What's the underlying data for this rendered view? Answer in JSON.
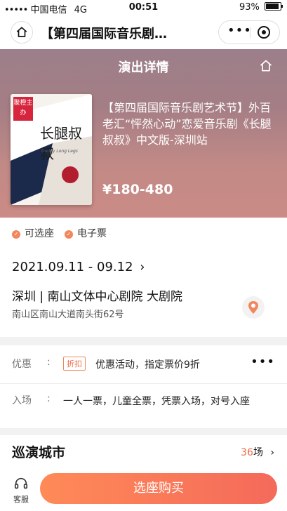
{
  "status_bar": {
    "carrier": "中国电信",
    "network": "4G",
    "time": "00:51",
    "battery": "93%"
  },
  "nav": {
    "title": "【第四届国际音乐剧…"
  },
  "hero": {
    "title": "演出详情",
    "poster": {
      "badge": "聚橙主办",
      "title": "长腿叔叔",
      "subtitle": "Daddy Long Legs"
    },
    "show_name": "【第四届国际音乐剧艺术节】外百老汇“怦然心动”恋爱音乐剧《长腿叔叔》中文版-深圳站",
    "price": "¥180-480"
  },
  "tags": [
    {
      "label": "可选座"
    },
    {
      "label": "电子票"
    }
  ],
  "info": {
    "date": "2021.09.11 - 09.12",
    "venue": "深圳 | 南山文体中心剧院 大剧院",
    "address": "南山区南山大道南头街62号"
  },
  "promo": {
    "label": "优惠",
    "badge": "折扣",
    "text": "优惠活动，指定票价9折",
    "entry_label": "入场",
    "entry_text": "一人一票，儿童全票，凭票入场，对号入座"
  },
  "tour": {
    "title": "巡演城市",
    "count": "36",
    "unit": "场"
  },
  "bottom": {
    "service_label": "客服",
    "buy_label": "选座购买"
  },
  "colors": {
    "accent": "#f06a45",
    "buy_gradient_start": "#ff8a57",
    "buy_gradient_end": "#f46a5b"
  },
  "icons": [
    "signal-icon",
    "wifi-icon",
    "battery-icon",
    "home-icon",
    "more-icon",
    "target-icon",
    "check-icon",
    "chevron-right-icon",
    "map-pin-icon",
    "headset-icon"
  ]
}
